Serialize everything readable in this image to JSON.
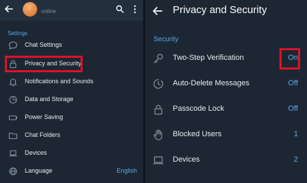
{
  "left_panel": {
    "status": "online",
    "section": "Settings",
    "items": [
      {
        "label": "Chat Settings",
        "icon": "chat-bubble-icon"
      },
      {
        "label": "Privacy and Security",
        "icon": "lock-icon"
      },
      {
        "label": "Notifications and Sounds",
        "icon": "bell-icon"
      },
      {
        "label": "Data and Storage",
        "icon": "pie-chart-icon"
      },
      {
        "label": "Power Saving",
        "icon": "battery-icon"
      },
      {
        "label": "Chat Folders",
        "icon": "folder-icon"
      },
      {
        "label": "Devices",
        "icon": "laptop-icon"
      },
      {
        "label": "Language",
        "icon": "globe-icon",
        "value": "English"
      }
    ]
  },
  "right_panel": {
    "title": "Privacy and Security",
    "section": "Security",
    "items": [
      {
        "label": "Two-Step Verification",
        "value": "On",
        "icon": "key-icon"
      },
      {
        "label": "Auto-Delete Messages",
        "value": "Off",
        "icon": "timer-icon"
      },
      {
        "label": "Passcode Lock",
        "value": "Off",
        "icon": "lock-icon"
      },
      {
        "label": "Blocked Users",
        "value": "1",
        "icon": "hand-icon"
      },
      {
        "label": "Devices",
        "value": "2",
        "icon": "laptop-icon"
      }
    ]
  },
  "colors": {
    "background": "#1d2733",
    "header": "#242f3d",
    "accent": "#5fa8e8",
    "highlight": "#e0102a"
  }
}
